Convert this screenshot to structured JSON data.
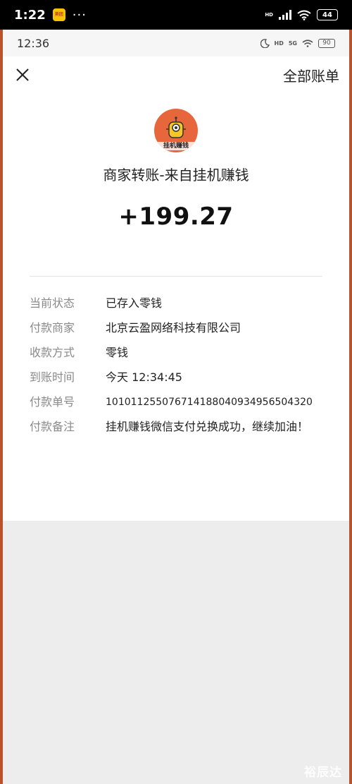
{
  "outer_status": {
    "time": "1:22",
    "app_badge": "美团",
    "dots": "···",
    "hd": "HD",
    "battery": "44"
  },
  "inner_status": {
    "time": "12:36",
    "hd": "HD",
    "network": "5G",
    "battery": "90"
  },
  "nav": {
    "close_icon": "close-icon",
    "all_bills_label": "全部账单"
  },
  "detail": {
    "avatar_text": "挂机赚钱",
    "title": "商家转账-来自挂机赚钱",
    "amount": "+199.27",
    "rows": [
      {
        "label": "当前状态",
        "value": "已存入零钱"
      },
      {
        "label": "付款商家",
        "value": "北京云盈网络科技有限公司"
      },
      {
        "label": "收款方式",
        "value": "零钱"
      },
      {
        "label": "到账时间",
        "value": "今天 12:34:45"
      },
      {
        "label": "付款单号",
        "value": "10101125507671418804093495650432​0"
      },
      {
        "label": "付款备注",
        "value": "挂机赚钱微信支付兑换成功，继续加油！"
      }
    ]
  },
  "watermark": "裕辰达",
  "colors": {
    "frame_accent": "#b8532b",
    "avatar_bg": "#e8663b",
    "page_bg": "#ededed"
  }
}
